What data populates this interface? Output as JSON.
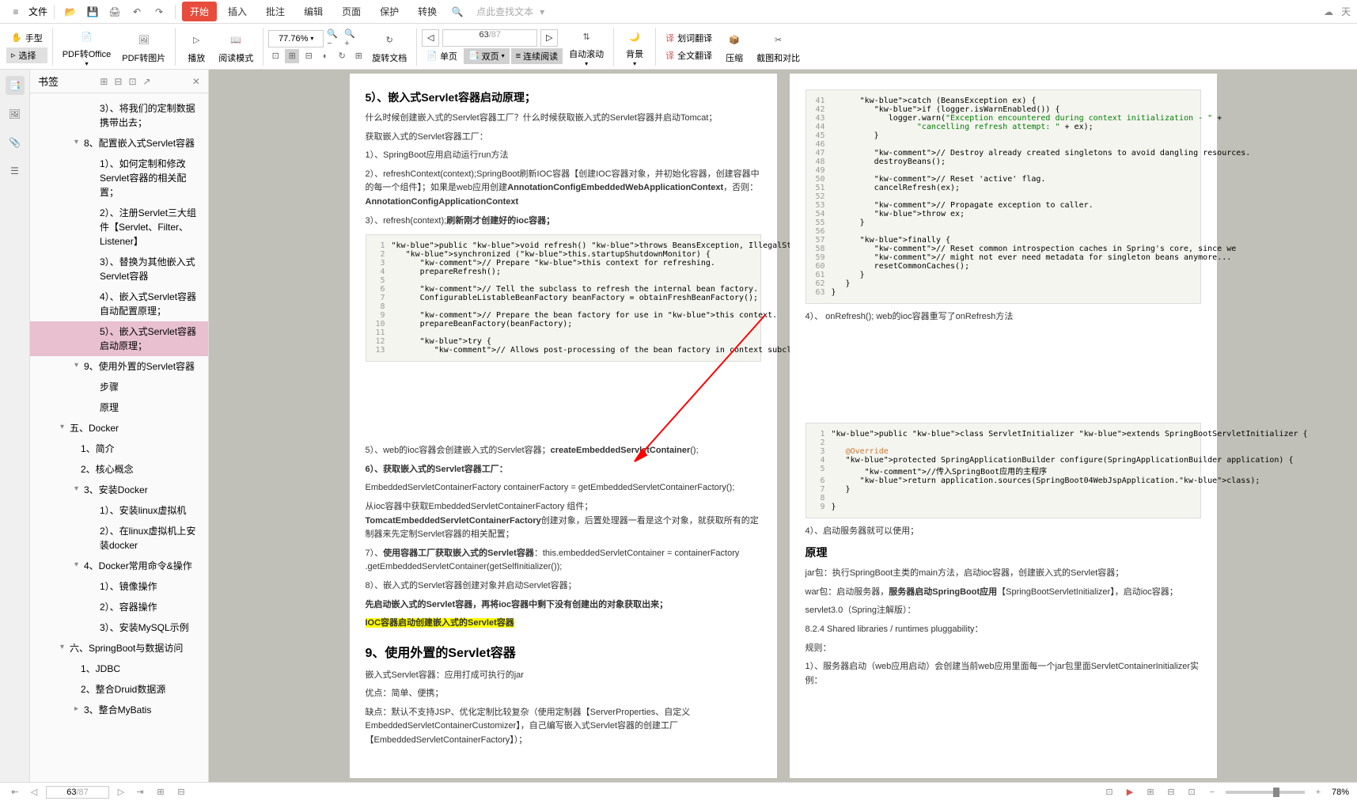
{
  "menubar": {
    "file": "文件",
    "tabs": [
      "开始",
      "插入",
      "批注",
      "编辑",
      "页面",
      "保护",
      "转换"
    ],
    "search": "点此查找文本"
  },
  "ribbon": {
    "hand": "手型",
    "select": "选择",
    "pdf_office": "PDF转Office",
    "pdf_image": "PDF转图片",
    "play": "播放",
    "read_mode": "阅读模式",
    "zoom": "77.76%",
    "rotate": "旋转文档",
    "single": "单页",
    "double": "双页",
    "continuous": "连续阅读",
    "auto_scroll": "自动滚动",
    "background": "背景",
    "word_trans": "划词翻译",
    "full_trans": "全文翻译",
    "compress": "压缩",
    "screenshot": "截图和对比",
    "page_cur": "63",
    "page_total": "/87"
  },
  "sidebar": {
    "title": "书签",
    "items": [
      {
        "label": "3）、将我们的定制数据携带出去；",
        "cls": "lvl2"
      },
      {
        "label": "8、配置嵌入式Servlet容器",
        "cls": "hdr2 expanded"
      },
      {
        "label": "1）、如何定制和修改Servlet容器的相关配置；",
        "cls": "lvl2"
      },
      {
        "label": "2）、注册Servlet三大组件【Servlet、Filter、Listener】",
        "cls": "lvl2"
      },
      {
        "label": "3）、替换为其他嵌入式Servlet容器",
        "cls": "lvl2"
      },
      {
        "label": "4）、嵌入式Servlet容器自动配置原理；",
        "cls": "lvl2"
      },
      {
        "label": "5）、嵌入式Servlet容器启动原理；",
        "cls": "lvl2 selected"
      },
      {
        "label": "9、使用外置的Servlet容器",
        "cls": "hdr2 expanded"
      },
      {
        "label": "步骤",
        "cls": "lvl2"
      },
      {
        "label": "原理",
        "cls": "lvl2"
      },
      {
        "label": "五、Docker",
        "cls": "hdr expanded"
      },
      {
        "label": "1、简介",
        "cls": "lvl1"
      },
      {
        "label": "2、核心概念",
        "cls": "lvl1"
      },
      {
        "label": "3、安装Docker",
        "cls": "hdr2 expanded"
      },
      {
        "label": "1）、安装linux虚拟机",
        "cls": "lvl2"
      },
      {
        "label": "2）、在linux虚拟机上安装docker",
        "cls": "lvl2"
      },
      {
        "label": "4、Docker常用命令&操作",
        "cls": "hdr2 expanded"
      },
      {
        "label": "1）、镜像操作",
        "cls": "lvl2"
      },
      {
        "label": "2）、容器操作",
        "cls": "lvl2"
      },
      {
        "label": "3）、安装MySQL示例",
        "cls": "lvl2"
      },
      {
        "label": "六、SpringBoot与数据访问",
        "cls": "hdr expanded"
      },
      {
        "label": "1、JDBC",
        "cls": "lvl1"
      },
      {
        "label": "2、整合Druid数据源",
        "cls": "lvl1"
      },
      {
        "label": "3、整合MyBatis",
        "cls": "hdr2"
      }
    ]
  },
  "page_left": {
    "h1": "5）、嵌入式Servlet容器启动原理；",
    "p1": "什么时候创建嵌入式的Servlet容器工厂？什么时候获取嵌入式的Servlet容器并启动Tomcat；",
    "p2": "获取嵌入式的Servlet容器工厂：",
    "p3": "1）、SpringBoot应用启动运行run方法",
    "p4a": "2）、refreshContext(context);SpringBoot刷新IOC容器【创建IOC容器对象，并初始化容器，创建容器中的每一个组件】；如果是web应用创建",
    "p4b": "AnnotationConfigEmbeddedWebApplicationContext",
    "p4c": "，否则：",
    "p4d": "AnnotationConfigApplicationContext",
    "p5": "3）、refresh(context);",
    "p5b": "刷新刚才创建好的ioc容器；",
    "code1": {
      "lines": [
        {
          "n": "1",
          "t": "public void refresh() throws BeansException, IllegalStateException {",
          "c": "kw"
        },
        {
          "n": "2",
          "t": "   synchronized (this.startupShutdownMonitor) {",
          "c": ""
        },
        {
          "n": "3",
          "t": "      // Prepare this context for refreshing.",
          "c": "comment"
        },
        {
          "n": "4",
          "t": "      prepareRefresh();",
          "c": ""
        },
        {
          "n": "5",
          "t": "",
          "c": ""
        },
        {
          "n": "6",
          "t": "      // Tell the subclass to refresh the internal bean factory.",
          "c": "comment"
        },
        {
          "n": "7",
          "t": "      ConfigurableListableBeanFactory beanFactory = obtainFreshBeanFactory();",
          "c": ""
        },
        {
          "n": "8",
          "t": "",
          "c": ""
        },
        {
          "n": "9",
          "t": "      // Prepare the bean factory for use in this context.",
          "c": "comment"
        },
        {
          "n": "10",
          "t": "      prepareBeanFactory(beanFactory);",
          "c": ""
        },
        {
          "n": "11",
          "t": "",
          "c": ""
        },
        {
          "n": "12",
          "t": "      try {",
          "c": ""
        },
        {
          "n": "13",
          "t": "         // Allows post-processing of the bean factory in context subclasses.",
          "c": "comment"
        }
      ]
    },
    "p6a": "5）、web的ioc容器会创建嵌入式的Servlet容器；",
    "p6b": "createEmbeddedServletContainer",
    "p6c": "();",
    "h2": "6）、获取嵌入式的Servlet容器工厂：",
    "p7": "EmbeddedServletContainerFactory containerFactory = getEmbeddedServletContainerFactory();",
    "p8a": "从ioc容器中获取EmbeddedServletContainerFactory 组件；",
    "p8b": "TomcatEmbeddedServletContainerFactory",
    "p8c": "创建对象，后置处理器一看是这个对象，就获取所有的定制器来先定制Servlet容器的相关配置；",
    "p9a": "7）、",
    "p9b": "使用容器工厂获取嵌入式的Servlet容器",
    "p9c": "：this.embeddedServletContainer = containerFactory .getEmbeddedServletContainer(getSelfInitializer());",
    "p10": "8）、嵌入式的Servlet容器创建对象并启动Servlet容器；",
    "p11": "先启动嵌入式的Servlet容器，再将ioc容器中剩下没有创建出的对象获取出来；",
    "p12": "IOC容器启动创建嵌入式的Servlet容器",
    "h3": "9、使用外置的Servlet容器",
    "p13": "嵌入式Servlet容器：应用打成可执行的jar",
    "p14": "优点：简单、便携；",
    "p15": "缺点：默认不支持JSP、优化定制比较复杂（使用定制器【ServerProperties、自定义EmbeddedServletContainerCustomizer】，自己编写嵌入式Servlet容器的创建工厂【EmbeddedServletContainerFactory】）；"
  },
  "page_right": {
    "code1": {
      "lines": [
        {
          "n": "41",
          "t": "      catch (BeansException ex) {"
        },
        {
          "n": "42",
          "t": "         if (logger.isWarnEnabled()) {"
        },
        {
          "n": "43",
          "t": "            logger.warn(\"Exception encountered during context initialization - \" +"
        },
        {
          "n": "44",
          "t": "                  \"cancelling refresh attempt: \" + ex);"
        },
        {
          "n": "45",
          "t": "         }"
        },
        {
          "n": "46",
          "t": ""
        },
        {
          "n": "47",
          "t": "         // Destroy already created singletons to avoid dangling resources."
        },
        {
          "n": "48",
          "t": "         destroyBeans();"
        },
        {
          "n": "49",
          "t": ""
        },
        {
          "n": "50",
          "t": "         // Reset 'active' flag."
        },
        {
          "n": "51",
          "t": "         cancelRefresh(ex);"
        },
        {
          "n": "52",
          "t": ""
        },
        {
          "n": "53",
          "t": "         // Propagate exception to caller."
        },
        {
          "n": "54",
          "t": "         throw ex;"
        },
        {
          "n": "55",
          "t": "      }"
        },
        {
          "n": "56",
          "t": ""
        },
        {
          "n": "57",
          "t": "      finally {"
        },
        {
          "n": "58",
          "t": "         // Reset common introspection caches in Spring's core, since we"
        },
        {
          "n": "59",
          "t": "         // might not ever need metadata for singleton beans anymore..."
        },
        {
          "n": "60",
          "t": "         resetCommonCaches();"
        },
        {
          "n": "61",
          "t": "      }"
        },
        {
          "n": "62",
          "t": "   }"
        },
        {
          "n": "63",
          "t": "}"
        }
      ]
    },
    "p1": "4）、 onRefresh(); web的ioc容器重写了onRefresh方法",
    "code2": {
      "lines": [
        {
          "n": "1",
          "t": "public class ServletInitializer extends SpringBootServletInitializer {"
        },
        {
          "n": "2",
          "t": ""
        },
        {
          "n": "3",
          "t": "   @Override"
        },
        {
          "n": "4",
          "t": "   protected SpringApplicationBuilder configure(SpringApplicationBuilder application) {"
        },
        {
          "n": "5",
          "t": "       //传入SpringBoot应用的主程序"
        },
        {
          "n": "6",
          "t": "      return application.sources(SpringBoot04WebJspApplication.class);"
        },
        {
          "n": "7",
          "t": "   }"
        },
        {
          "n": "8",
          "t": ""
        },
        {
          "n": "9",
          "t": "}"
        }
      ]
    },
    "p2": "4）、启动服务器就可以使用；",
    "h1": "原理",
    "p3": "jar包：执行SpringBoot主类的main方法，启动ioc容器，创建嵌入式的Servlet容器；",
    "p4a": "war包：启动服务器，",
    "p4b": "服务器启动SpringBoot应用",
    "p4c": "【SpringBootServletInitializer】，启动ioc容器；",
    "p5": "servlet3.0（Spring注解版）：",
    "p6": "8.2.4 Shared libraries / runtimes pluggability：",
    "p7": "规则：",
    "p8": "1）、服务器启动（web应用启动）会创建当前web应用里面每一个jar包里面ServletContainerInitializer实例："
  },
  "statusbar": {
    "page_cur": "63",
    "page_total": "/87",
    "zoom": "78%"
  }
}
